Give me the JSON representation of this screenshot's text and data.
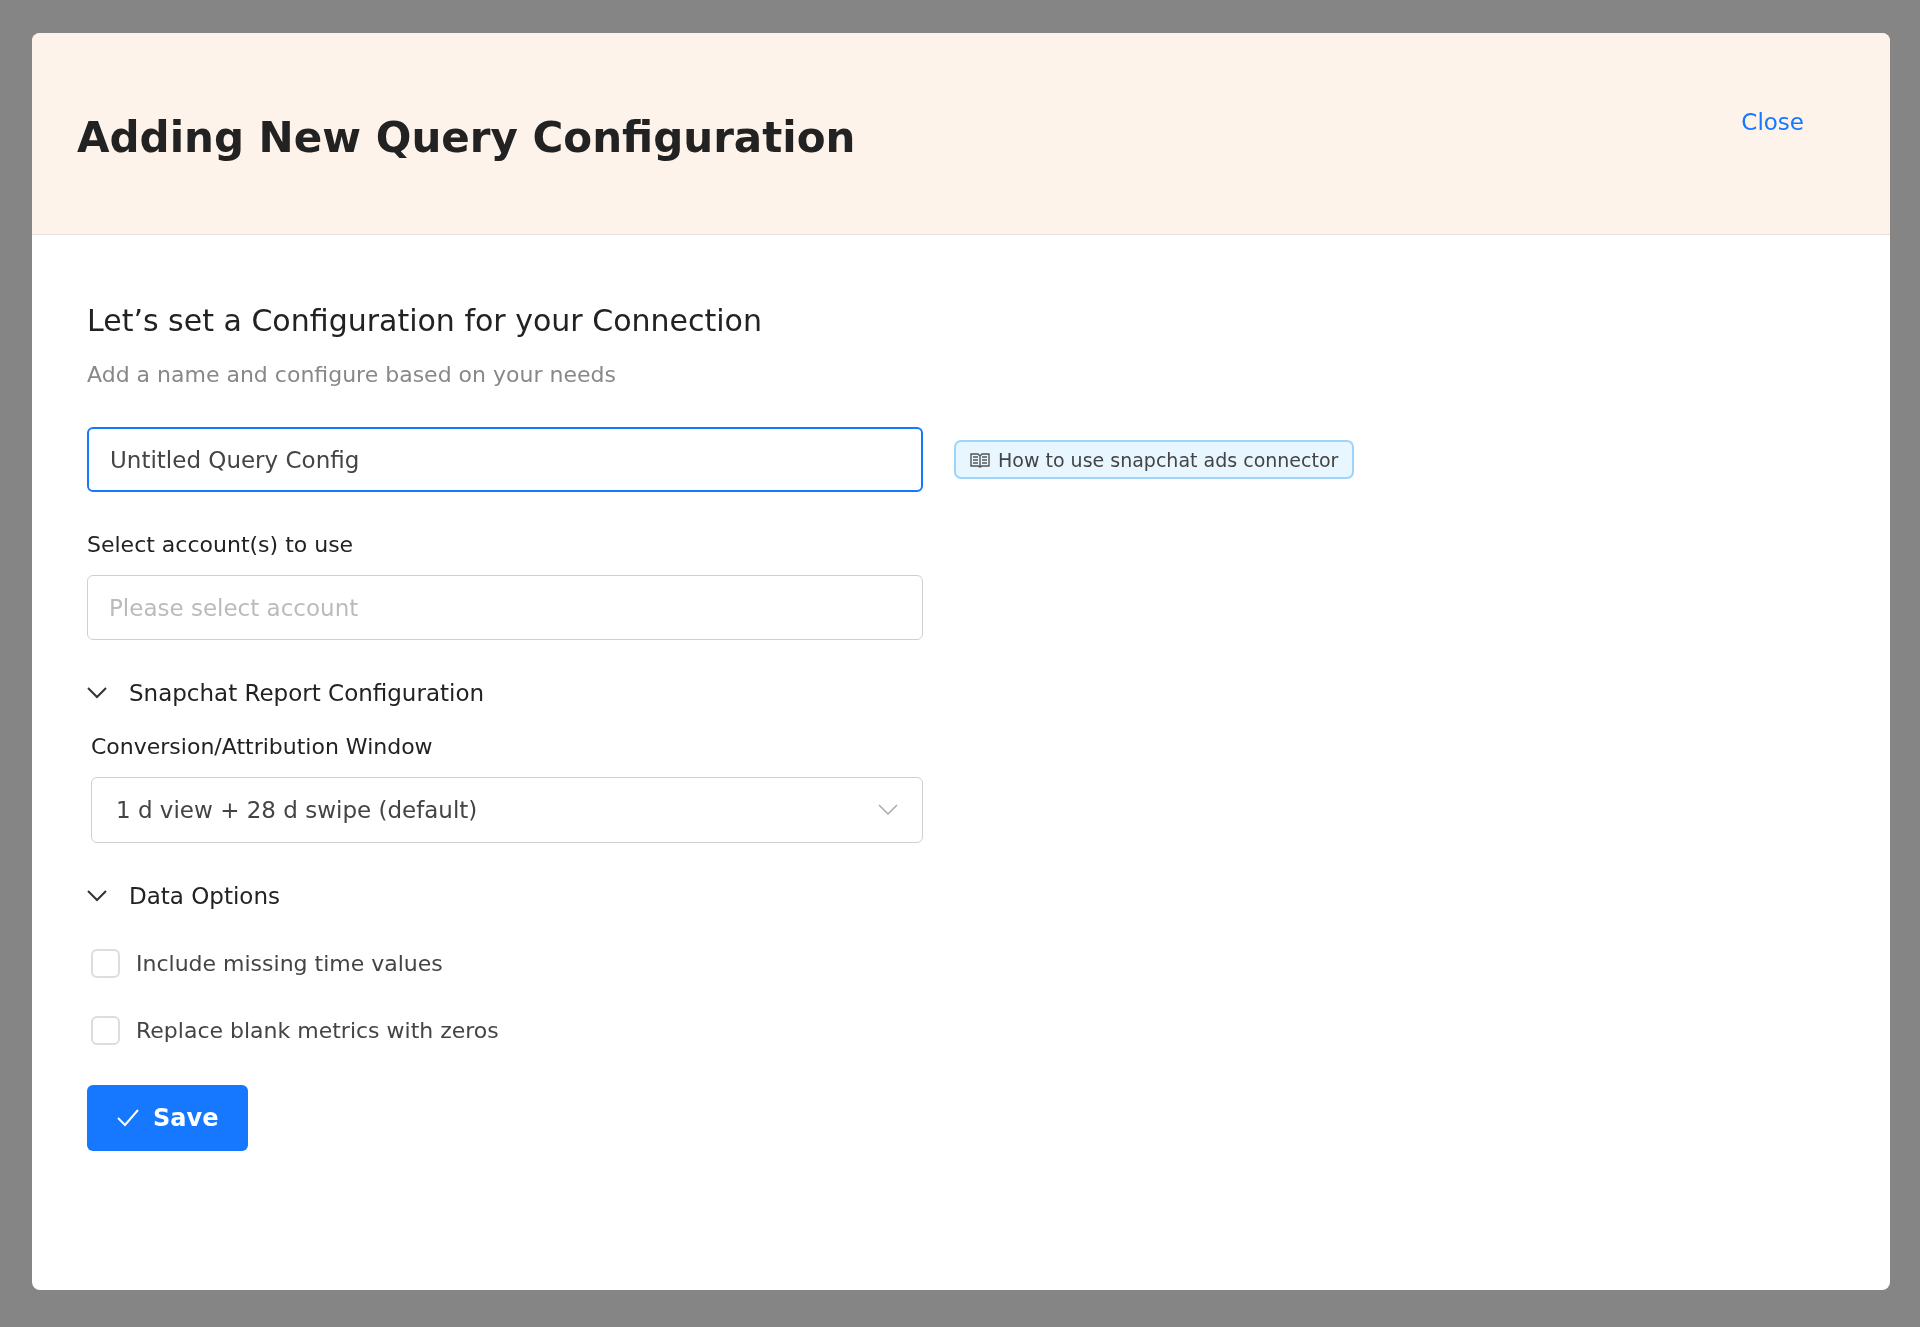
{
  "dialog": {
    "title": "Adding New Query Configuration",
    "close_label": "Close"
  },
  "intro": {
    "heading": "Let’s set a Configuration for your Connection",
    "subtitle": "Add a name and configure based on your needs"
  },
  "name_field": {
    "value": "Untitled Query Config",
    "focused": true
  },
  "help_link": {
    "label": "How to use snapchat ads connector"
  },
  "account_field": {
    "label": "Select account(s) to use",
    "placeholder": "Please select account"
  },
  "sections": [
    {
      "title": "Snapchat Report Configuration",
      "expanded": true,
      "kind": "dropdown",
      "field_label": "Conversion/Attribution Window",
      "value": "1 d view + 28 d swipe (default)"
    },
    {
      "title": "Data Options",
      "expanded": true,
      "kind": "checkboxes",
      "options": [
        {
          "label": "Include missing time values",
          "checked": false
        },
        {
          "label": "Replace blank metrics with zeros",
          "checked": false
        }
      ]
    }
  ],
  "save_button": {
    "label": "Save"
  }
}
